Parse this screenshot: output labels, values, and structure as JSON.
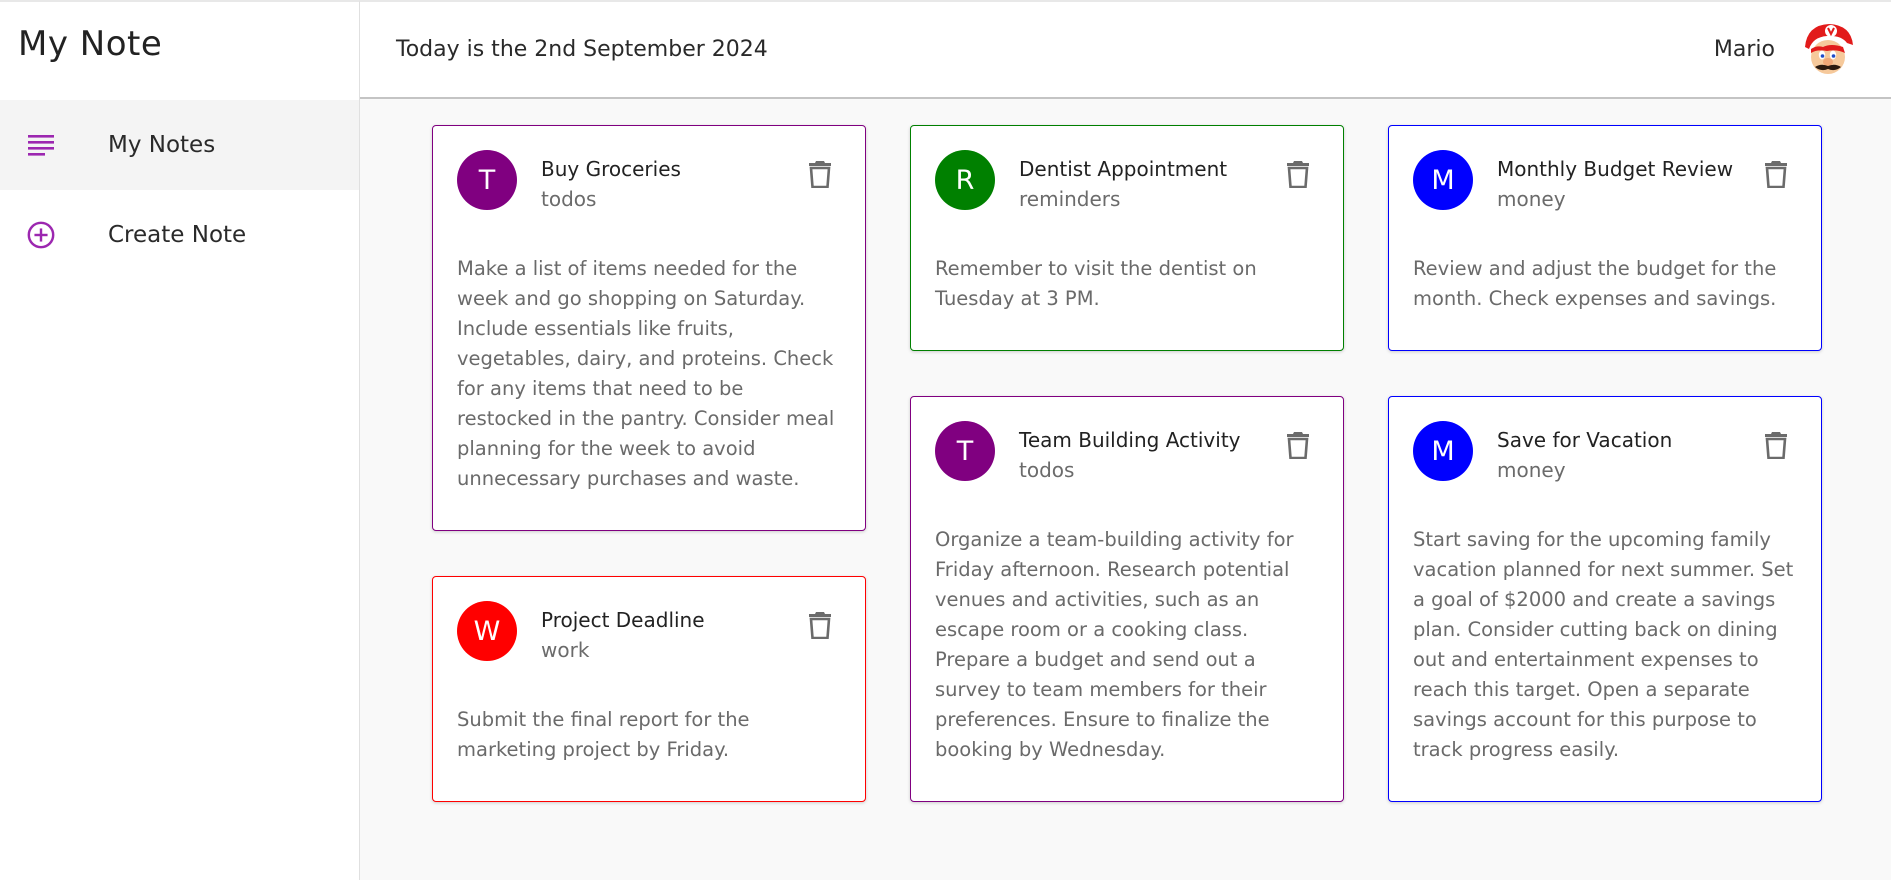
{
  "sidebar": {
    "app_title": "My Note",
    "items": [
      {
        "label": "My Notes",
        "icon": "notes-list-icon",
        "active": true
      },
      {
        "label": "Create Note",
        "icon": "add-circle-icon",
        "active": false
      }
    ],
    "accent_color": "#9c27b0"
  },
  "header": {
    "date_text": "Today is the 2nd September 2024",
    "user_name": "Mario",
    "avatar_icon": "mario-avatar-icon"
  },
  "notes": [
    {
      "title": "Buy Groceries",
      "category": "todos",
      "initial": "T",
      "color": "#800080",
      "body": "Make a list of items needed for the week and go shopping on Saturday. Include essentials like fruits, vegetables, dairy, and proteins. Check for any items that need to be restocked in the pantry. Consider meal planning for the week to avoid unnecessary purchases and waste."
    },
    {
      "title": "Project Deadline",
      "category": "work",
      "initial": "W",
      "color": "#ff0000",
      "body": "Submit the final report for the marketing project by Friday."
    },
    {
      "title": "Dentist Appointment",
      "category": "reminders",
      "initial": "R",
      "color": "#008000",
      "body": "Remember to visit the dentist on Tuesday at 3 PM."
    },
    {
      "title": "Team Building Activity",
      "category": "todos",
      "initial": "T",
      "color": "#800080",
      "body": "Organize a team-building activity for Friday afternoon. Research potential venues and activities, such as an escape room or a cooking class. Prepare a budget and send out a survey to team members for their preferences. Ensure to finalize the booking by Wednesday."
    },
    {
      "title": "Monthly Budget Review",
      "category": "money",
      "initial": "M",
      "color": "#0000ff",
      "body": "Review and adjust the budget for the month. Check expenses and savings."
    },
    {
      "title": "Save for Vacation",
      "category": "money",
      "initial": "M",
      "color": "#0000ff",
      "body": "Start saving for the upcoming family vacation planned for next summer. Set a goal of $2000 and create a savings plan. Consider cutting back on dining out and entertainment expenses to reach this target. Open a separate savings account for this purpose to track progress easily."
    }
  ],
  "icons": {
    "delete": "trash-icon"
  }
}
